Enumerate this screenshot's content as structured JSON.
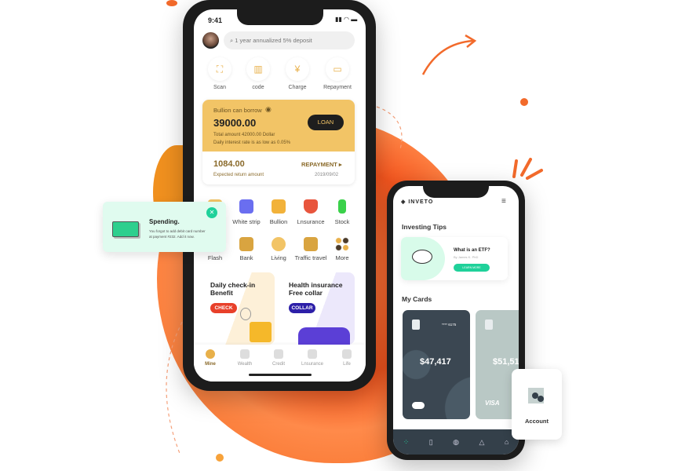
{
  "colors": {
    "accent": "#f26a2b",
    "gold": "#f2c466",
    "green": "#1fd19a",
    "dark": "#3b4752"
  },
  "phone1": {
    "status_time": "9:41",
    "search_placeholder": "1 year annualized 5% deposit",
    "quick_actions": [
      {
        "label": "Scan",
        "icon": "scan-icon"
      },
      {
        "label": "code",
        "icon": "barcode-icon"
      },
      {
        "label": "Charge",
        "icon": "charge-icon"
      },
      {
        "label": "Repayment",
        "icon": "card-icon"
      }
    ],
    "loan_card": {
      "title": "Bullion can borrow",
      "amount": "39000.00",
      "button": "LOAN",
      "total": "Total amount 42000.00 Dollar",
      "rate": "Daily interest rate is as low as 0.05%",
      "return_amount": "1084.00",
      "return_label": "Expected return amount",
      "repayment": "REPAYMENT ▸",
      "date": "2019/09/02"
    },
    "grid": [
      {
        "label": "",
        "color": "#f2c466"
      },
      {
        "label": "White strip",
        "color": "#6a6ef0"
      },
      {
        "label": "Bullion",
        "color": "#f2b23a"
      },
      {
        "label": "Lnsurance",
        "color": "#e8553d"
      },
      {
        "label": "Stock",
        "color": "#3ad14a"
      },
      {
        "label": "Flash",
        "color": "#f2c466"
      },
      {
        "label": "Bank",
        "color": "#d9a440"
      },
      {
        "label": "Living",
        "color": "#f2c466"
      },
      {
        "label": "Traffic travel",
        "color": "#d9a440"
      },
      {
        "label": "More",
        "color": "#6b5a3a"
      }
    ],
    "banners": [
      {
        "title1": "Daily check-in",
        "title2": "Benefit",
        "button": "CHECK"
      },
      {
        "title1": "Health insurance",
        "title2": "Free collar",
        "button": "COLLAR"
      }
    ],
    "nav": [
      "Mine",
      "Wealth",
      "Credit",
      "Lnsurance",
      "Life"
    ]
  },
  "popup": {
    "title": "Spending.",
    "text1": "You forgot to add debit card number",
    "text2": "at payment #232. Add it now."
  },
  "phone2": {
    "brand": "INVETO",
    "tips_title": "Investing Tips",
    "tip": {
      "title": "What is an ETF?",
      "author": "By James K. PhD",
      "button": "LEARN MORE"
    },
    "cards_title": "My Cards",
    "card1": {
      "number": "**** 6175",
      "amount": "$47,417"
    },
    "card2": {
      "amount": "$51,51",
      "brand": "VISA"
    },
    "nav": [
      "grid-icon",
      "book-icon",
      "user-icon",
      "bell-icon",
      "home-icon"
    ]
  },
  "account": {
    "label": "Account"
  }
}
